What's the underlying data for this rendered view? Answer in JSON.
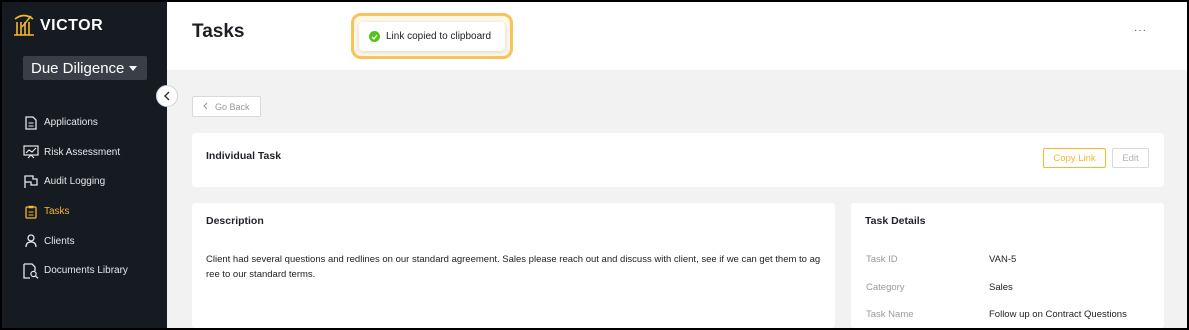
{
  "app": {
    "logo_text": "VICTOR",
    "org_selector": "Due Diligence"
  },
  "sidebar": {
    "items": [
      {
        "label": "Applications",
        "icon": "document-icon",
        "active": false
      },
      {
        "label": "Risk Assessment",
        "icon": "chart-board-icon",
        "active": false
      },
      {
        "label": "Audit Logging",
        "icon": "flag-icon",
        "active": false
      },
      {
        "label": "Tasks",
        "icon": "clipboard-icon",
        "active": true
      },
      {
        "label": "Clients",
        "icon": "user-icon",
        "active": false
      },
      {
        "label": "Documents Library",
        "icon": "document-search-icon",
        "active": false
      }
    ]
  },
  "header": {
    "title": "Tasks",
    "more": "···"
  },
  "toast": {
    "message": "Link copied to clipboard"
  },
  "main": {
    "go_back": "Go Back",
    "individual_card": {
      "title": "Individual Task",
      "copy_link": "Copy Link",
      "edit": "Edit"
    },
    "description_card": {
      "title": "Description",
      "text": "Client had several questions and redlines on our standard agreement. Sales please reach out and discuss with client, see if we can get them to agree to our standard terms."
    },
    "details_card": {
      "title": "Task Details",
      "rows": [
        {
          "key": "Task ID",
          "value": "VAN-5"
        },
        {
          "key": "Category",
          "value": "Sales"
        },
        {
          "key": "Task Name",
          "value": "Follow up on Contract Questions"
        }
      ]
    }
  },
  "colors": {
    "accent": "#f5b82e",
    "sidebar_bg": "#161b22",
    "success": "#52c41a"
  }
}
